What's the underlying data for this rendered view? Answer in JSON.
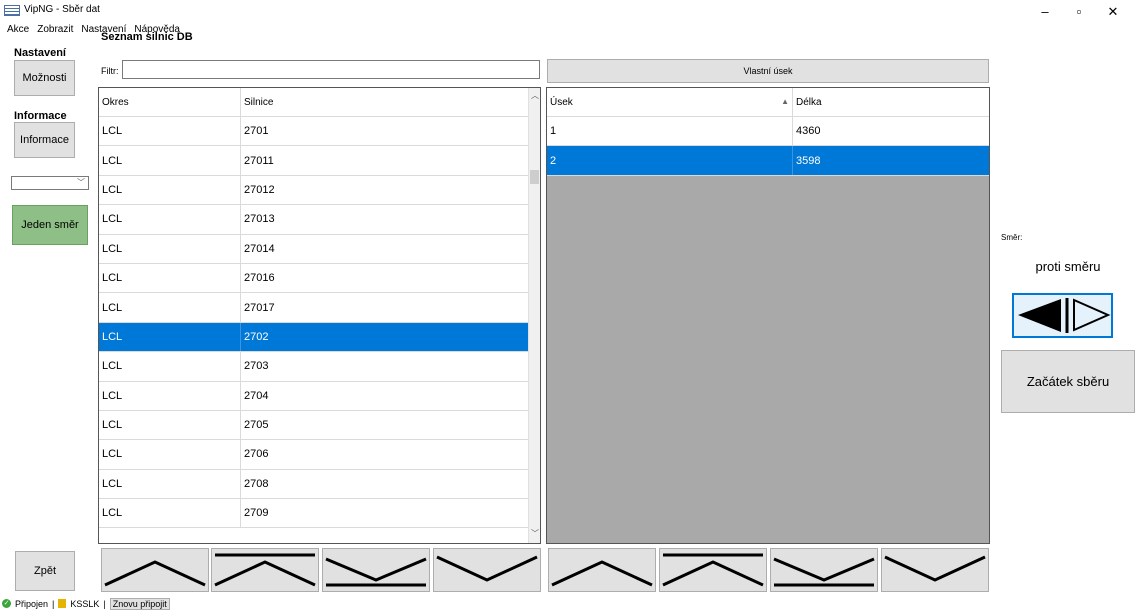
{
  "window": {
    "title": "VipNG - Sběr dat",
    "min": "–",
    "max": "▫",
    "close": "✕"
  },
  "menu": [
    "Akce",
    "Zobrazit",
    "Nastavení",
    "Nápověda"
  ],
  "left": {
    "nastaveni_label": "Nastavení",
    "moznosti": "Možnosti",
    "informace_label": "Informace",
    "informace": "Informace",
    "jeden_smer": "Jeden směr",
    "zpet": "Zpět"
  },
  "roads": {
    "title": "Seznam silnic DB",
    "filter_label": "Filtr:",
    "filter_value": "",
    "columns": [
      "Okres",
      "Silnice"
    ],
    "rows": [
      [
        "LCL",
        "2701"
      ],
      [
        "LCL",
        "27011"
      ],
      [
        "LCL",
        "27012"
      ],
      [
        "LCL",
        "27013"
      ],
      [
        "LCL",
        "27014"
      ],
      [
        "LCL",
        "27016"
      ],
      [
        "LCL",
        "27017"
      ],
      [
        "LCL",
        "2702"
      ],
      [
        "LCL",
        "2703"
      ],
      [
        "LCL",
        "2704"
      ],
      [
        "LCL",
        "2705"
      ],
      [
        "LCL",
        "2706"
      ],
      [
        "LCL",
        "2708"
      ],
      [
        "LCL",
        "2709"
      ]
    ],
    "selected": 7
  },
  "segments": {
    "vlastni_usek": "Vlastní úsek",
    "columns": [
      "Úsek",
      "Délka"
    ],
    "rows": [
      [
        "1",
        "4360"
      ],
      [
        "2",
        "3598"
      ]
    ],
    "selected": 1
  },
  "right": {
    "smer_label": "Směr:",
    "smer_value": "proti směru",
    "zacatek": "Začátek sběru"
  },
  "status": {
    "connected": "Připojen",
    "sep1": "|",
    "db": "KSSLK",
    "sep2": "|",
    "reconnect": "Znovu připojit"
  }
}
